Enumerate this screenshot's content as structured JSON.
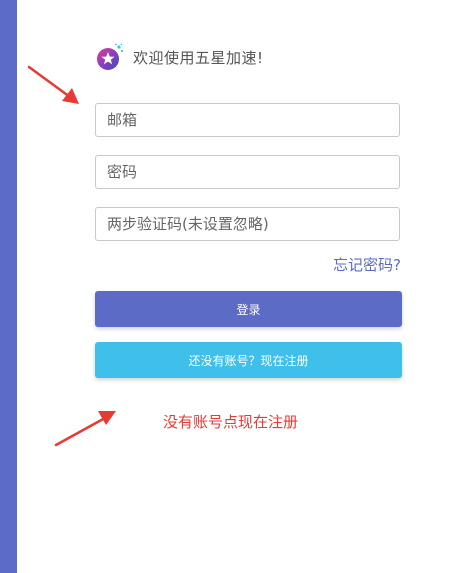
{
  "header": {
    "welcome": "欢迎使用五星加速!"
  },
  "form": {
    "email_placeholder": "邮箱",
    "password_placeholder": "密码",
    "twofa_placeholder": "两步验证码(未设置忽略)",
    "forgot_label": "忘记密码?",
    "login_label": "登录",
    "register_label": "还没有账号？现在注册"
  },
  "annotation": {
    "text": "没有账号点现在注册"
  },
  "colors": {
    "sidebar": "#5b6bc7",
    "login_button": "#5c6bc5",
    "register_button": "#3ec0eb",
    "annotation": "#e83a33",
    "link": "#5b6bc7"
  },
  "icons": {
    "logo": "star-rocket-logo-icon",
    "arrows": "red-arrow-icon"
  }
}
